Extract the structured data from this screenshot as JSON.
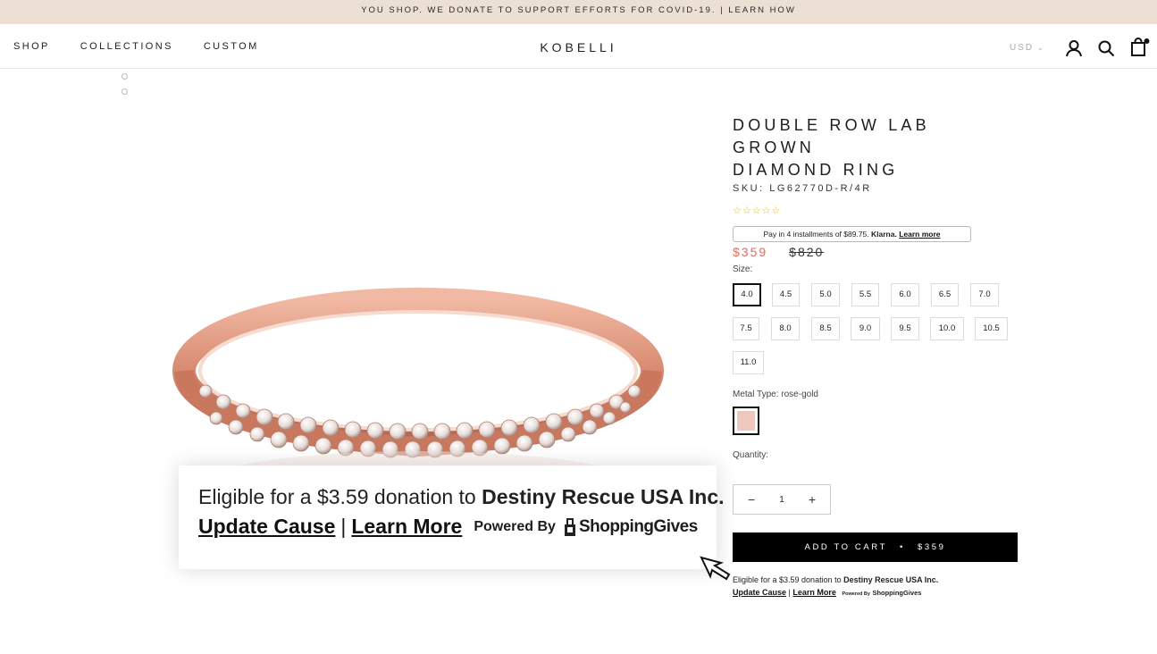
{
  "announcement": {
    "text": "YOU SHOP. WE DONATE TO SUPPORT EFFORTS FOR COVID-19. | LEARN HOW"
  },
  "header": {
    "nav": [
      "SHOP",
      "COLLECTIONS",
      "CUSTOM"
    ],
    "logo": "KOBELLI",
    "currency": "USD",
    "icons": [
      "account-icon",
      "search-icon",
      "cart-icon"
    ]
  },
  "gallery": {
    "dot_count": 2
  },
  "product": {
    "title_line1": "DOUBLE ROW LAB GROWN",
    "title_line2": "DIAMOND RING",
    "sku": "SKU: LG62770D-R/4R",
    "rating_stars": "☆☆☆☆☆",
    "klarna": {
      "text": "Pay in 4 installments of $89.75.",
      "brand": "Klarna.",
      "link": "Learn more"
    },
    "price": "$359",
    "compare_price": "$820",
    "size_label": "Size:",
    "sizes": [
      "4.0",
      "4.5",
      "5.0",
      "5.5",
      "6.0",
      "6.5",
      "7.0",
      "7.5",
      "8.0",
      "8.5",
      "9.0",
      "9.5",
      "10.0",
      "10.5",
      "11.0"
    ],
    "selected_size": "4.0",
    "metal_label": "Metal Type: rose-gold",
    "metal_color": "#eec8bc",
    "quantity_label": "Quantity:",
    "quantity": "1",
    "add_to_cart": "ADD TO CART",
    "cart_separator": "•",
    "cart_price": "$359"
  },
  "donation": {
    "prefix": "Eligible for a $3.59 donation to",
    "org": "Destiny Rescue USA Inc.",
    "update_cause": "Update Cause",
    "separator": "|",
    "learn_more": "Learn More",
    "powered_by": "Powered By",
    "provider": "ShoppingGives"
  }
}
